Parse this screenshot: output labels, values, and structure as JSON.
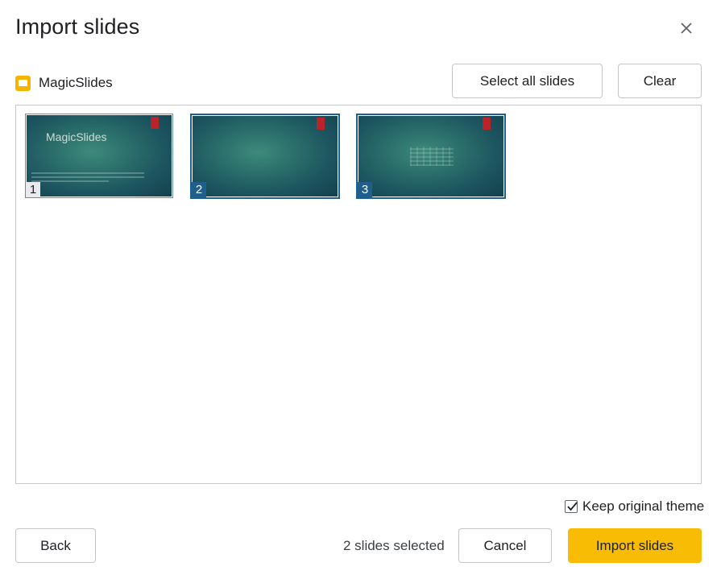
{
  "dialog": {
    "title": "Import slides",
    "close_icon": "close-icon"
  },
  "source": {
    "icon": "google-slides-icon",
    "name": "MagicSlides"
  },
  "toolbar": {
    "select_all_label": "Select all slides",
    "clear_label": "Clear"
  },
  "slides": [
    {
      "number": "1",
      "selected": false,
      "title": "MagicSlides"
    },
    {
      "number": "2",
      "selected": true
    },
    {
      "number": "3",
      "selected": true
    }
  ],
  "options": {
    "keep_theme_label": "Keep original theme",
    "keep_theme_checked": true
  },
  "footer": {
    "back_label": "Back",
    "status": "2 slides selected",
    "cancel_label": "Cancel",
    "import_label": "Import slides",
    "import_color": "#f9bc04"
  },
  "colors": {
    "selection_border": "#1e5f8c",
    "slide_flag": "#b8242a",
    "source_icon": "#f4b400"
  }
}
